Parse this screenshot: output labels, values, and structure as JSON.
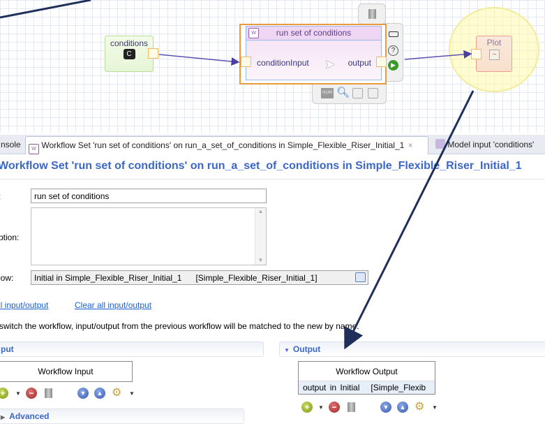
{
  "canvas": {
    "nodes": {
      "conditions": {
        "label": "conditions",
        "badge": "C"
      },
      "run": {
        "label": "run set of conditions",
        "input_port": "conditionInput",
        "output_port": "output"
      },
      "plot": {
        "label": "Plot"
      }
    },
    "toolbar_icons": [
      "trash-icon",
      "rename-icon",
      "help-icon",
      "run-icon",
      "num-icon",
      "zoom-icon",
      "workflow-in-icon",
      "workflow-out-icon"
    ],
    "num_label": "NUM"
  },
  "tabs": [
    {
      "label": "nsole"
    },
    {
      "label": "Workflow Set 'run set of conditions' on run_a_set_of_conditions in Simple_Flexible_Riser_Initial_1",
      "close": "×"
    },
    {
      "label": "Model input 'conditions'"
    }
  ],
  "editor": {
    "title": "Workflow Set 'run set of conditions' on run_a_set_of_conditions in Simple_Flexible_Riser_Initial_1",
    "name_label": ":",
    "name_value": "run set of conditions",
    "description_label": "ption:",
    "description_value": "",
    "workflow_label": "low:",
    "workflow_value": "Initial in Simple_Flexible_Riser_Initial_1      [Simple_Flexible_Riser_Initial_1]",
    "link_match": "ll input/output",
    "link_clear": "Clear all input/output",
    "info": "switch the workflow, input/output from the previous workflow will be matched to the new by name.",
    "input_section": {
      "title": "put",
      "table_header": "Workflow Input",
      "rows": []
    },
    "output_section": {
      "title": "Output",
      "table_header": "Workflow Output",
      "rows": [
        {
          "name": "output in Initial",
          "source": "[Simple_Flexib"
        }
      ]
    },
    "advanced": "Advanced"
  },
  "colors": {
    "accent": "#3a67c8",
    "link": "#1a5fd6",
    "arrow": "#1e2f5a"
  }
}
